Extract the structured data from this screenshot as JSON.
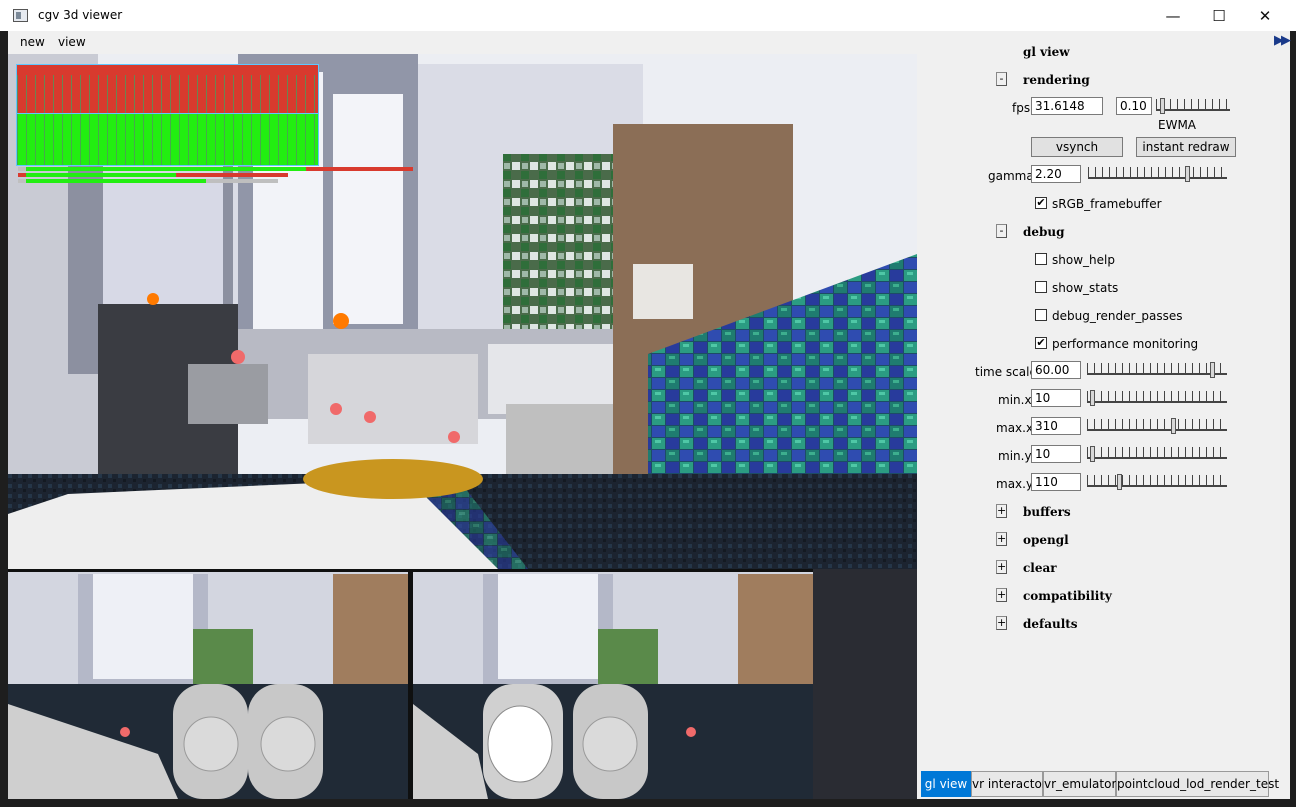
{
  "window": {
    "title": "cgv 3d viewer",
    "controls": [
      "—",
      "☐",
      "✕"
    ]
  },
  "menubar": {
    "items": [
      "new",
      "view"
    ]
  },
  "gl_view": {
    "title": "gl view",
    "rendering": {
      "toggle": "-",
      "label": "rendering",
      "fps_label": "fps",
      "fps_value": "31.6148",
      "ewma_value": "0.10",
      "ewma_label": "EWMA",
      "vsynch_label": "vsynch",
      "instant_redraw_label": "instant redraw",
      "gamma_label": "gamma",
      "gamma_value": "2.20",
      "srgb_label": "sRGB_framebuffer",
      "srgb_checked": "✔"
    },
    "debug": {
      "toggle": "-",
      "label": "debug",
      "show_help_label": "show_help",
      "show_stats_label": "show_stats",
      "debug_render_passes_label": "debug_render_passes",
      "performance_monitoring_label": "performance monitoring",
      "performance_monitoring_checked": "✔",
      "time_scale_label": "time scale",
      "time_scale_value": "60.00",
      "min_x_label": "min.x",
      "min_x_value": "10",
      "max_x_label": "max.x",
      "max_x_value": "310",
      "min_y_label": "min.y",
      "min_y_value": "10",
      "max_y_label": "max.y",
      "max_y_value": "110"
    },
    "collapsed_groups": [
      {
        "toggle": "+",
        "label": "buffers"
      },
      {
        "toggle": "+",
        "label": "opengl"
      },
      {
        "toggle": "+",
        "label": "clear"
      },
      {
        "toggle": "+",
        "label": "compatibility"
      },
      {
        "toggle": "+",
        "label": "defaults"
      }
    ]
  },
  "tabs": [
    {
      "label": "gl view",
      "active": true
    },
    {
      "label": "vr interactor",
      "active": false
    },
    {
      "label": "vr_emulator",
      "active": false
    },
    {
      "label": "pointcloud_lod_render_test",
      "active": false
    }
  ],
  "colors": {
    "perf_red": "#d83a2e",
    "perf_green": "#22ee11",
    "tab_active": "#0078d7",
    "panel_bg": "#f0f0f0"
  }
}
